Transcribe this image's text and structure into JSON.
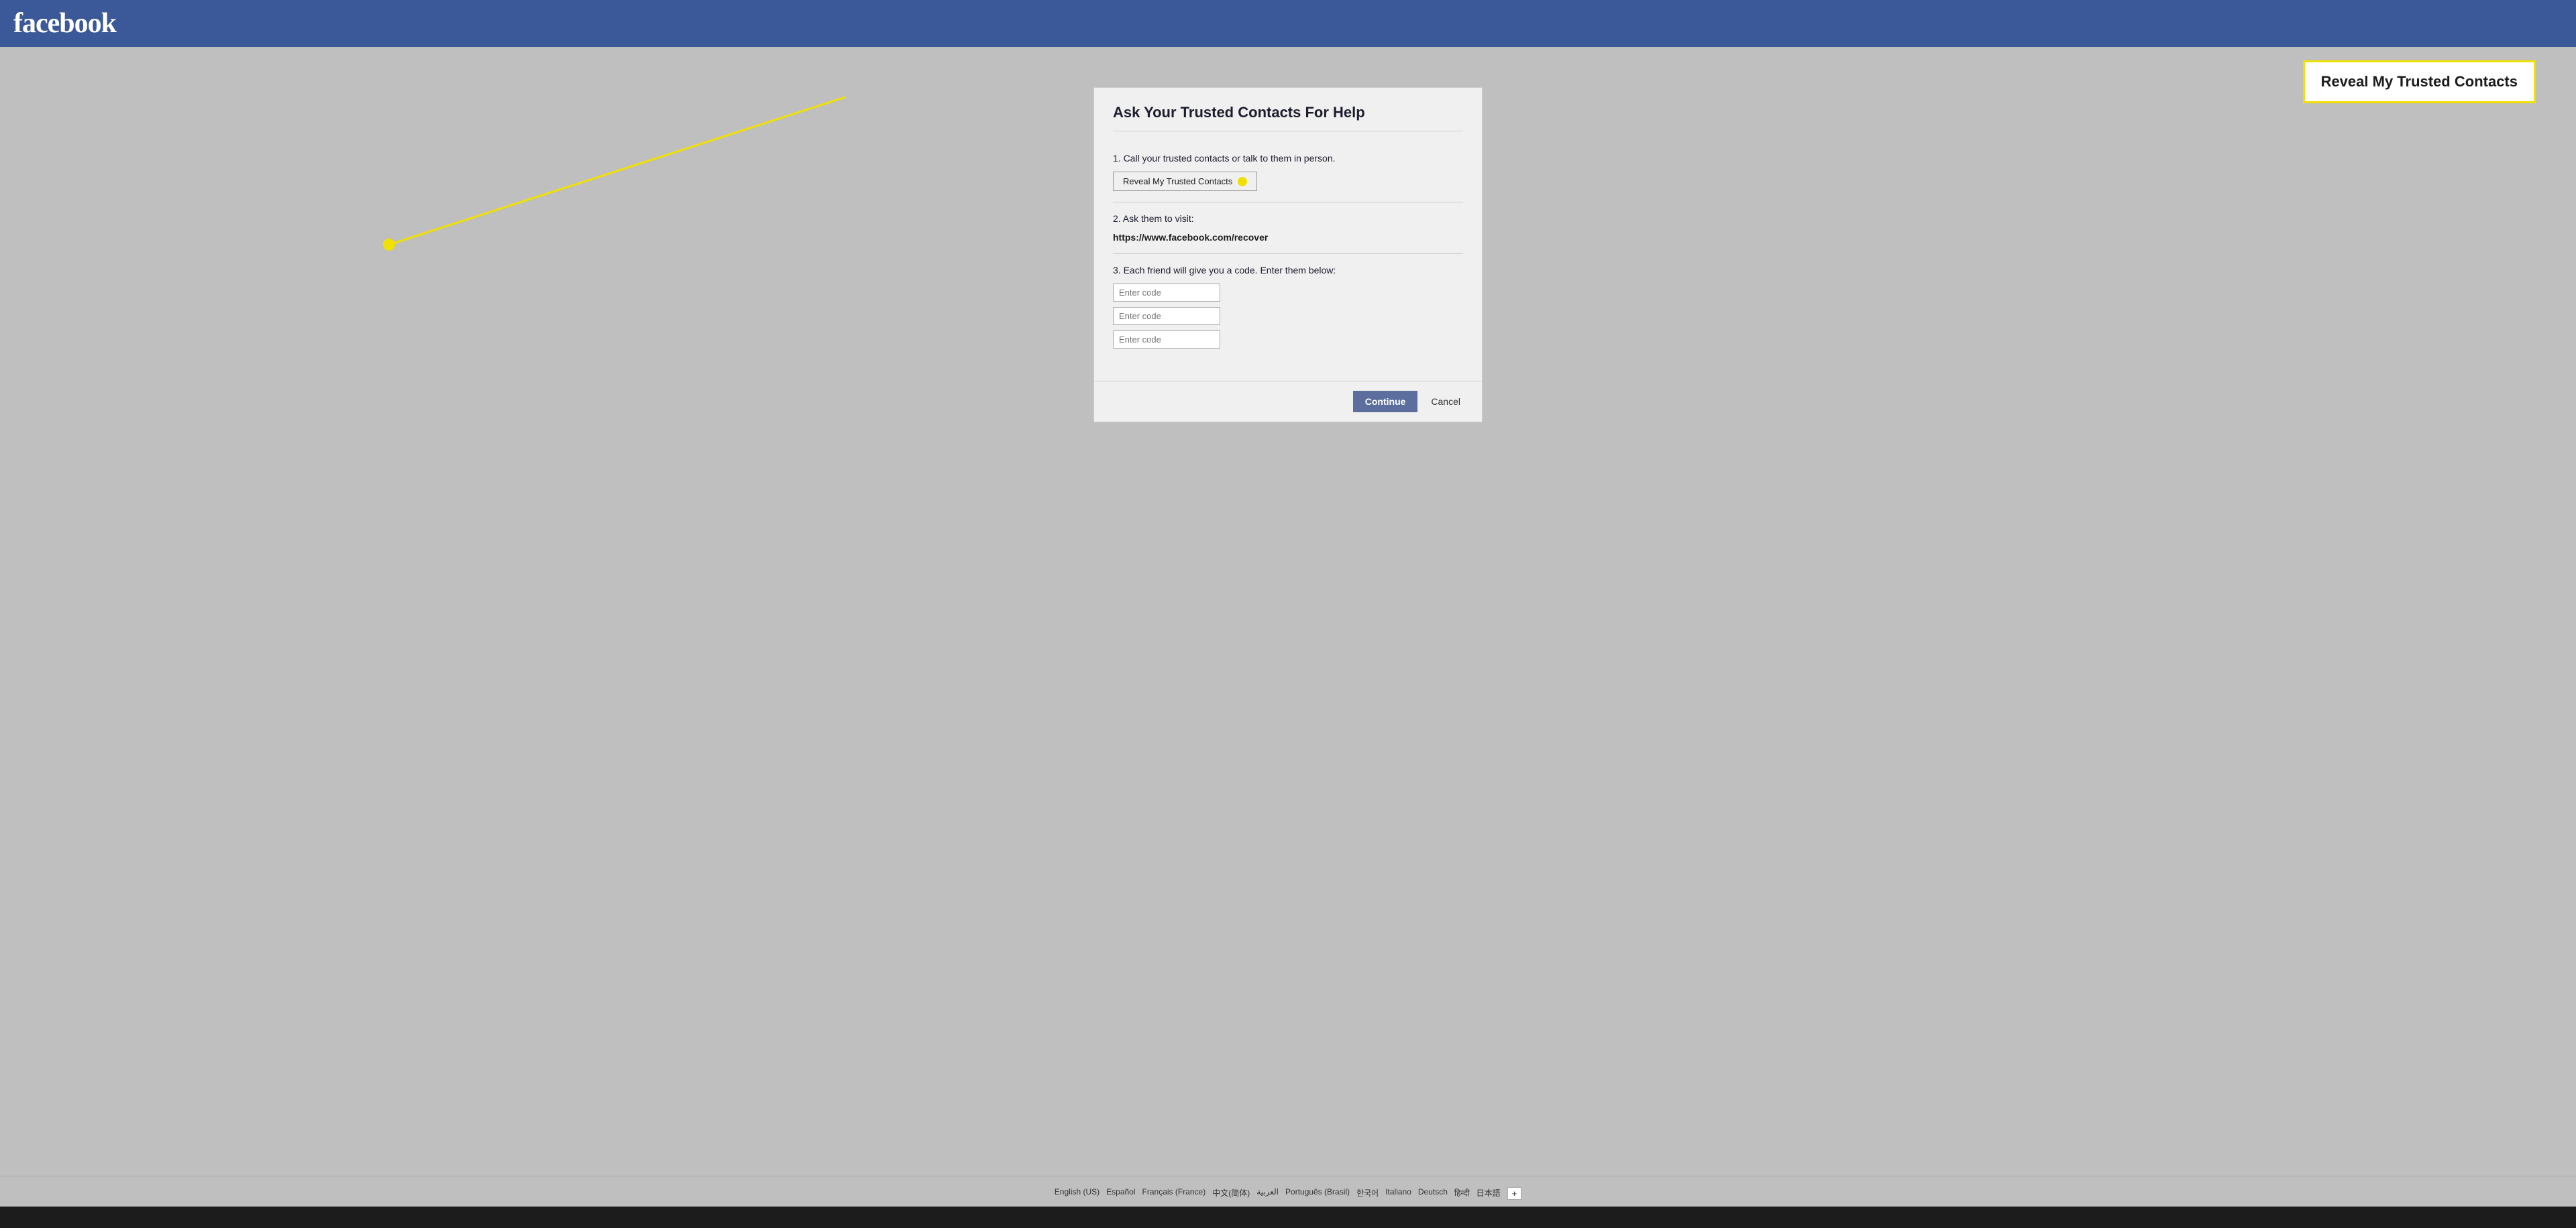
{
  "header": {
    "logo": "facebook"
  },
  "annotation": {
    "label": "Reveal My Trusted Contacts"
  },
  "dialog": {
    "title": "Ask Your Trusted Contacts For Help",
    "step1": {
      "text": "1. Call your trusted contacts or talk to them in person.",
      "button_label": "Reveal My Trusted Contacts"
    },
    "step2": {
      "text": "2. Ask them to visit:",
      "url": "https://www.facebook.com/recover"
    },
    "step3": {
      "text": "3. Each friend will give you a code. Enter them below:",
      "inputs": [
        {
          "placeholder": "Enter code"
        },
        {
          "placeholder": "Enter code"
        },
        {
          "placeholder": "Enter code"
        }
      ]
    },
    "footer": {
      "continue_label": "Continue",
      "cancel_label": "Cancel"
    }
  },
  "footer": {
    "languages": [
      "English (US)",
      "Español",
      "Français (France)",
      "中文(简体)",
      "العربية",
      "Português (Brasil)",
      "한국어",
      "Italiano",
      "Deutsch",
      "हिन्दी",
      "日本語"
    ],
    "plus_label": "+"
  }
}
